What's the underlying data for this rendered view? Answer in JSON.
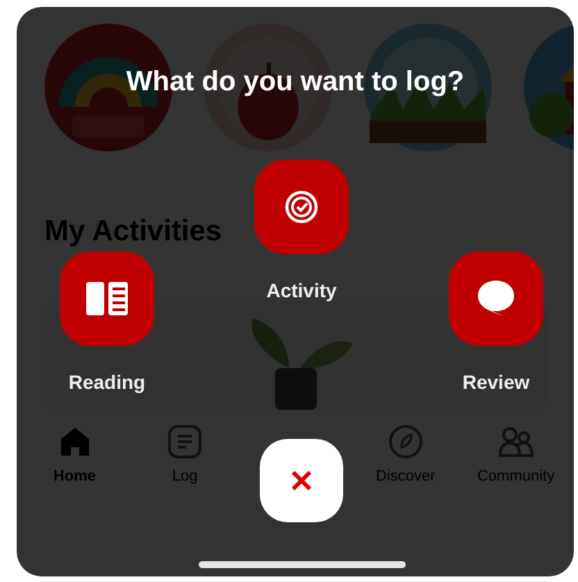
{
  "section_title": "My Activities",
  "tabs": [
    {
      "kind": "home",
      "label": "Home",
      "selected": true
    },
    {
      "kind": "log",
      "label": "Log",
      "selected": false
    },
    {
      "kind": "discover",
      "label": "Discover",
      "selected": false
    },
    {
      "kind": "community",
      "label": "Community",
      "selected": false
    }
  ],
  "overlay": {
    "title": "What do you want to log?",
    "options": [
      {
        "kind": "activity",
        "label": "Activity"
      },
      {
        "kind": "reading",
        "label": "Reading"
      },
      {
        "kind": "review",
        "label": "Review"
      }
    ]
  }
}
